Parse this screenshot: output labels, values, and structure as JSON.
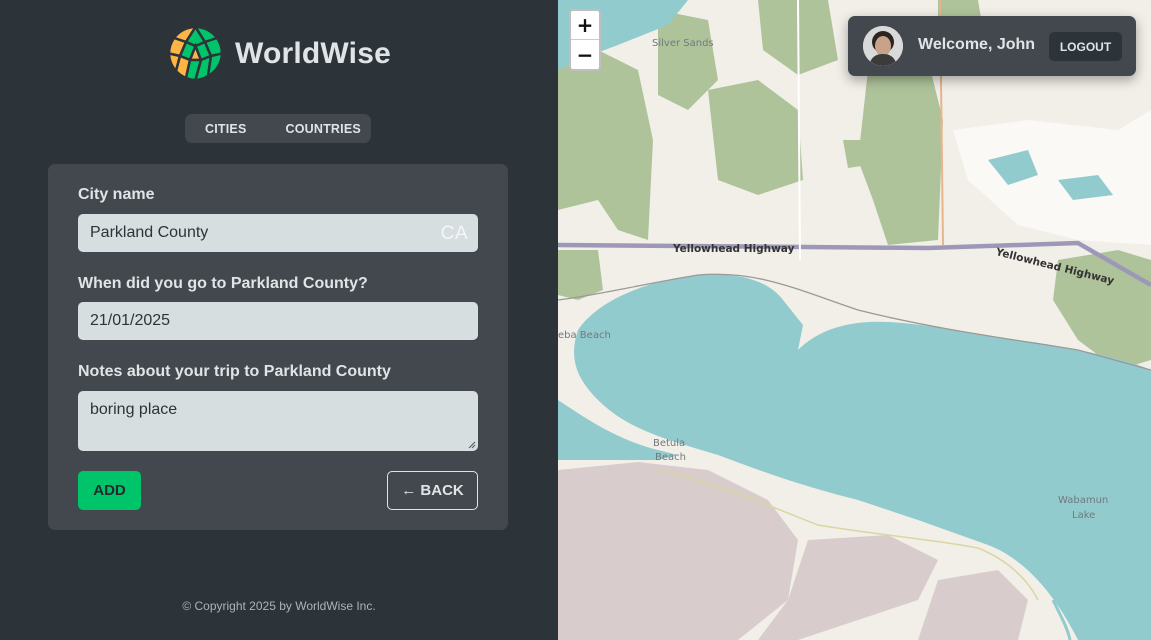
{
  "app": {
    "name": "WorldWise"
  },
  "nav": {
    "cities": "CITIES",
    "countries": "COUNTRIES"
  },
  "form": {
    "city_label": "City name",
    "city_value": "Parkland County",
    "country_code": "CA",
    "date_label": "When did you go to Parkland County?",
    "date_value": "21/01/2025",
    "notes_label": "Notes about your trip to Parkland County",
    "notes_value": "boring place",
    "add_label": "ADD",
    "back_label": "← BACK"
  },
  "footer": {
    "text": "© Copyright 2025 by WorldWise Inc."
  },
  "map": {
    "zoom_in": "+",
    "zoom_out": "−",
    "labels": {
      "silver_sands": "Silver Sands",
      "highway_1": "Yellowhead Highway",
      "highway_2": "Yellowhead Highway",
      "beach_left": "eba Beach",
      "betula": "Betula",
      "beach": "Beach",
      "wabamun": "Wabamun",
      "lake": "Lake"
    }
  },
  "user": {
    "welcome": "Welcome, John",
    "logout": "LOGOUT"
  },
  "colors": {
    "brand_green": "#00c46a",
    "sidebar_bg": "#2d3439",
    "panel_bg": "#42484d",
    "water": "#92cbcd",
    "forest": "#afc39b"
  }
}
